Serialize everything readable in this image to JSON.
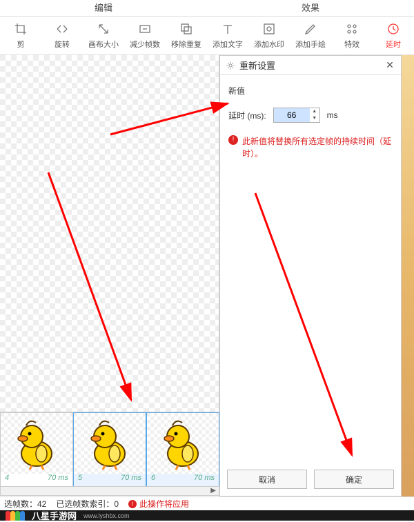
{
  "tabs": {
    "edit": "编辑",
    "effect": "效果"
  },
  "toolbar": {
    "crop": "剪",
    "rotate": "旋转",
    "canvas": "画布大小",
    "reduce": "减少帧数",
    "removeDup": "移除重复",
    "addText": "添加文字",
    "addWatermark": "添加水印",
    "addDraw": "添加手绘",
    "fx": "特效",
    "delay": "延时"
  },
  "panel": {
    "title": "重新设置",
    "newValueLabel": "新值",
    "delayLabel": "延时 (ms):",
    "delayValue": "66",
    "unit": "ms",
    "warning": "此新值将替换所有选定帧的持续时间（延时）。",
    "cancel": "取消",
    "ok": "确定"
  },
  "frames": [
    {
      "idx": "4",
      "ms": "70 ms"
    },
    {
      "idx": "5",
      "ms": "70 ms"
    },
    {
      "idx": "6",
      "ms": "70 ms"
    }
  ],
  "status": {
    "selCount": "选帧数：42",
    "selIndex": "已选帧数索引：0",
    "pending": "此操作将应用"
  },
  "footer": {
    "brand": "八星手游网",
    "site": "www.lyshbx.com"
  }
}
